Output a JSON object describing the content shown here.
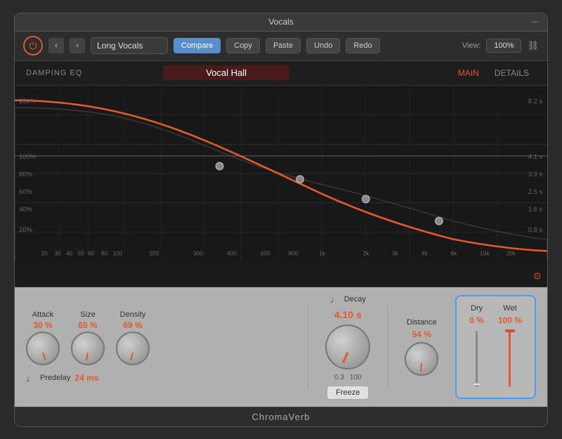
{
  "window": {
    "title": "Vocals",
    "minimize_label": "—"
  },
  "toolbar": {
    "power_label": "⏻",
    "nav_back": "‹",
    "nav_forward": "›",
    "preset_value": "Long Vocals",
    "compare_label": "Compare",
    "copy_label": "Copy",
    "paste_label": "Paste",
    "undo_label": "Undo",
    "redo_label": "Redo",
    "view_label": "View:",
    "view_value": "100%",
    "link_icon": "🔗"
  },
  "eq_section": {
    "label": "DAMPING EQ",
    "preset_name": "Vocal Hall",
    "main_tab": "MAIN",
    "details_tab": "DETAILS",
    "y_labels": [
      "200%",
      "100%",
      "80%",
      "60%",
      "40%",
      "20%"
    ],
    "x_labels": [
      "20",
      "30",
      "40",
      "50",
      "60",
      "80",
      "100",
      "200",
      "300",
      "400",
      "600",
      "800",
      "1k",
      "2k",
      "3k",
      "4k",
      "6k",
      "10k",
      "20k"
    ],
    "right_labels": [
      "8.2 s",
      "4.1 s",
      "3.3 s",
      "2.5 s",
      "1.6 s",
      "0.8 s"
    ]
  },
  "controls": {
    "attack_label": "Attack",
    "attack_value": "30 %",
    "size_label": "Size",
    "size_value": "65 %",
    "density_label": "Density",
    "density_value": "69 %",
    "decay_label": "Decay",
    "decay_value": "4.10 s",
    "distance_label": "Distance",
    "distance_value": "54 %",
    "predelay_label": "Predelay",
    "predelay_value": "24 ms",
    "freeze_min": "0.3",
    "freeze_max": "100",
    "freeze_btn": "Freeze",
    "dry_label": "Dry",
    "dry_value": "0 %",
    "wet_label": "Wet",
    "wet_value": "100 %"
  },
  "footer": {
    "plugin_name": "ChromaVerb"
  }
}
